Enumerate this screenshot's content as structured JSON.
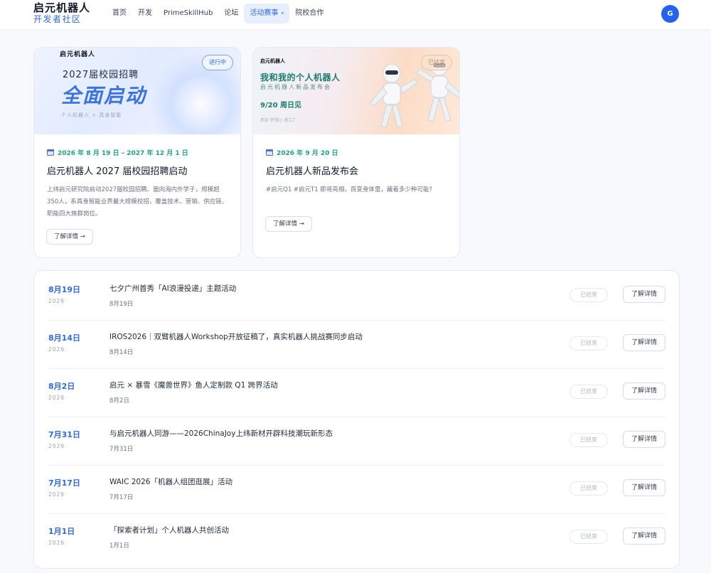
{
  "header": {
    "logo_main": "启元机器人",
    "logo_sub": "开发者社区",
    "nav": [
      "首页",
      "开发",
      "PrimeSkillHub",
      "论坛",
      "活动赛事",
      "院校合作"
    ],
    "nav_active_index": 4,
    "avatar_initial": "G"
  },
  "feature_cards": [
    {
      "banner": {
        "brand": "启元机器人",
        "year_line": "2027届校园招聘",
        "headline": "全面启动",
        "tagline": "个人机器人 × 具身智能",
        "status": "进行中"
      },
      "date": "2026 年 8 月 19 日 – 2027 年 12 月 1 日",
      "title": "启元机器人 2027 届校园招聘启动",
      "description": "上纬启元研究院启动2027届校园招聘、面向海内外学子，规模超350人，系具身智能业界最大规模校招，覆盖技术、营销、供应链、职能四大族群岗位。",
      "button": "了解详情 →"
    },
    {
      "banner": {
        "brand": "启元机器人",
        "headline": "我和我的个人机器人",
        "subline": "启元机器人新品发布会",
        "date_line": "9/20 周日见",
        "small": "西安·梦想小   新工厂",
        "status": "已结束"
      },
      "date": "2026 年 9 月 20 日",
      "title": "启元机器人新品发布会",
      "description": "#启元Q1 #启元T1 即将亮相，百变身体里，藏着多少种可能?",
      "button": "了解详情 →"
    }
  ],
  "events": [
    {
      "date": "8月19日",
      "year": "2026",
      "title": "七夕广州首秀「AI浪漫投递」主题活动",
      "subtitle": "8月19日",
      "status": "已结束",
      "button": "了解详情"
    },
    {
      "date": "8月14日",
      "year": "2026",
      "title": "IROS2026｜双臂机器人Workshop开放征稿了，真实机器人挑战赛同步启动",
      "subtitle": "8月14日",
      "status": "已结束",
      "button": "了解详情"
    },
    {
      "date": "8月2日",
      "year": "2026",
      "title": "启元 × 暴雪《魔兽世界》鱼人定制款 Q1 跨界活动",
      "subtitle": "8月2日",
      "status": "已结束",
      "button": "了解详情"
    },
    {
      "date": "7月31日",
      "year": "2026",
      "title": "与启元机器人同游——2026ChinaJoy上纬新材开辟科技潮玩新形态",
      "subtitle": "7月31日",
      "status": "已结束",
      "button": "了解详情"
    },
    {
      "date": "7月17日",
      "year": "2026",
      "title": "WAIC 2026「机器人组团逛展」活动",
      "subtitle": "7月17日",
      "status": "已结束",
      "button": "了解详情"
    },
    {
      "date": "1月1日",
      "year": "2026",
      "title": "「探索者计划」个人机器人共创活动",
      "subtitle": "1月1日",
      "status": "已结束",
      "button": "了解详情"
    }
  ]
}
